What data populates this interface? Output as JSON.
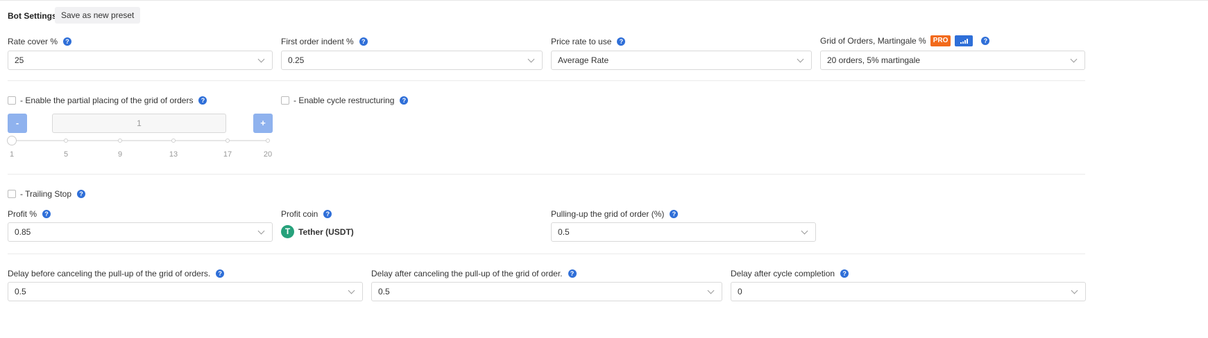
{
  "header": {
    "title": "Bot Settings",
    "preset_button": "Save as new preset"
  },
  "help_glyph": "?",
  "row1": {
    "rate_cover": {
      "label": "Rate cover %",
      "value": "25"
    },
    "first_order_indent": {
      "label": "First order indent %",
      "value": "0.25"
    },
    "price_rate": {
      "label": "Price rate to use",
      "value": "Average Rate"
    },
    "grid_orders": {
      "label": "Grid of Orders, Martingale %",
      "badge": "PRO",
      "value": "20 orders, 5% martingale"
    }
  },
  "partial_placing": {
    "label": "- Enable the partial placing of the grid of orders",
    "checked": false,
    "minus": "-",
    "plus": "+",
    "value": "1",
    "slider_value": 1,
    "ticks": [
      "1",
      "5",
      "9",
      "13",
      "17",
      "20"
    ]
  },
  "cycle_restructuring": {
    "label": "- Enable cycle restructuring",
    "checked": false
  },
  "trailing_stop": {
    "label": "- Trailing Stop",
    "checked": false
  },
  "profit": {
    "profit_pct": {
      "label": "Profit %",
      "value": "0.85"
    },
    "profit_coin": {
      "label": "Profit coin",
      "icon": "tether-coin-icon",
      "icon_glyph": "T",
      "value": "Tether (USDT)"
    },
    "pull_up": {
      "label": "Pulling-up the grid of order (%)",
      "value": "0.5"
    }
  },
  "delays": {
    "before_cancel": {
      "label": "Delay before canceling the pull-up of the grid of orders.",
      "value": "0.5"
    },
    "after_cancel": {
      "label": "Delay after canceling the pull-up of the grid of order.",
      "value": "0.5"
    },
    "after_cycle": {
      "label": "Delay after cycle completion",
      "value": "0"
    }
  },
  "colors": {
    "accent": "#2f6fd8",
    "pro_badge": "#f26a1b",
    "stepper": "#8fb2ee",
    "tether": "#26a17b"
  }
}
